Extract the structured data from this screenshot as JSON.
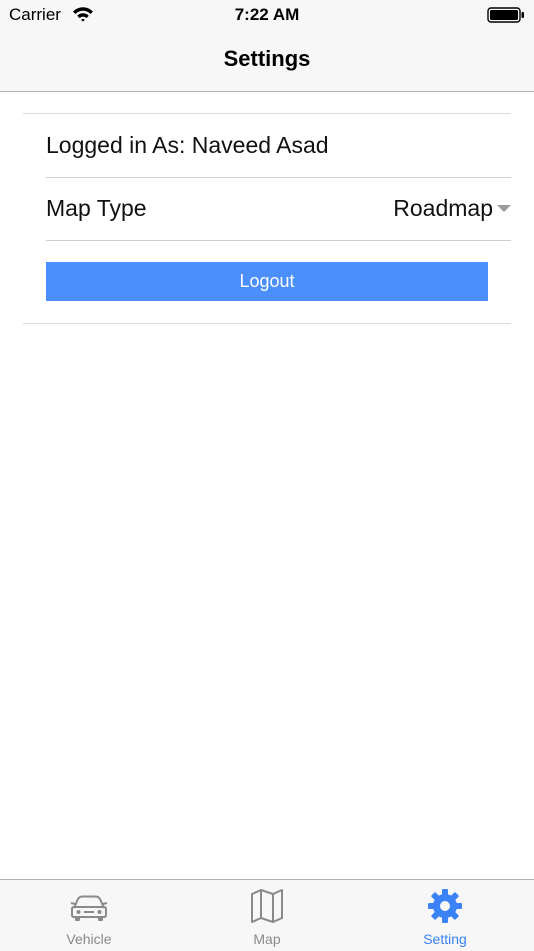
{
  "status_bar": {
    "carrier": "Carrier",
    "time": "7:22 AM"
  },
  "nav": {
    "title": "Settings"
  },
  "settings": {
    "logged_in_text": "Logged in As: Naveed Asad",
    "map_type_label": "Map Type",
    "map_type_value": "Roadmap",
    "logout_label": "Logout"
  },
  "tabs": [
    {
      "label": "Vehicle",
      "icon": "car-icon",
      "selected": false
    },
    {
      "label": "Map",
      "icon": "map-icon",
      "selected": false
    },
    {
      "label": "Setting",
      "icon": "gear-icon",
      "selected": true
    }
  ],
  "colors": {
    "accent": "#3a82f6",
    "button": "#4a8ffc",
    "inactive": "#8a8a8a",
    "bar_background": "#f7f7f7"
  }
}
